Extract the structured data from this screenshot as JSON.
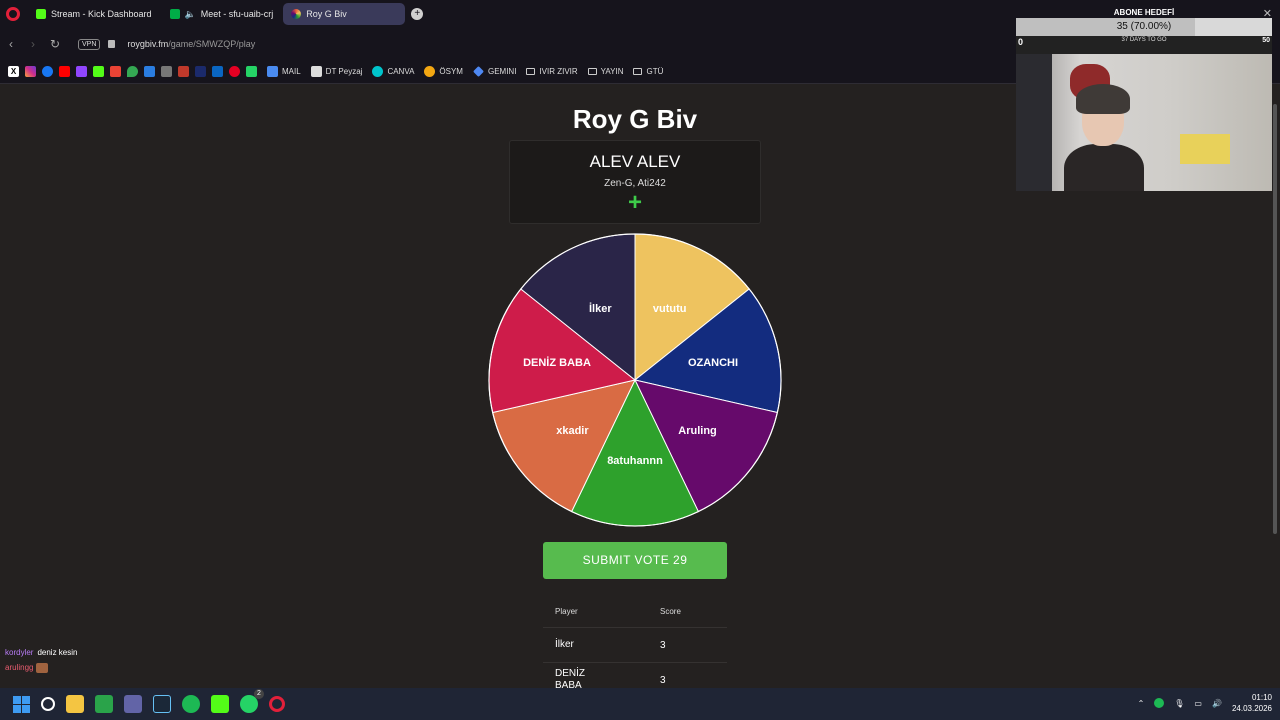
{
  "browser": {
    "tabs": [
      {
        "label": "Stream - Kick Dashboard",
        "color": "#53fc18"
      },
      {
        "label": "Meet - sfu-uaib-crj",
        "color": "#00ac47"
      },
      {
        "label": "Roy G Biv",
        "color": "#e85c3b"
      }
    ],
    "url_host": "roygbiv.fm",
    "url_path": "/game/SMWZQP/play",
    "vpn_label": "VPN",
    "bookmarks": [
      {
        "label": "MAIL",
        "icon": "mail-icon"
      },
      {
        "label": "DT Peyzaj",
        "icon": "dt-icon"
      },
      {
        "label": "CANVA",
        "icon": "canva-icon"
      },
      {
        "label": "ÖSYM",
        "icon": "osym-icon"
      },
      {
        "label": "GEMINI",
        "icon": "gemini-icon"
      },
      {
        "label": "IVIR ZIVIR",
        "icon": "folder-icon"
      },
      {
        "label": "YAYIN",
        "icon": "folder-icon"
      },
      {
        "label": "GTÜ",
        "icon": "folder-icon"
      }
    ]
  },
  "game": {
    "title": "Roy G Biv",
    "prompt": {
      "title": "ALEV ALEV",
      "subtitle": "Zen-G, Ati242",
      "add_symbol": "+"
    },
    "wheel": [
      {
        "label": "vututu",
        "color": "#eec35f"
      },
      {
        "label": "OZANCHI",
        "color": "#132c7f"
      },
      {
        "label": "Aruling",
        "color": "#660a6b"
      },
      {
        "label": "8atuhannn",
        "color": "#2ea12c"
      },
      {
        "label": "xkadir",
        "color": "#d96b44"
      },
      {
        "label": "DENİZ BABA",
        "color": "#ce1c4a"
      },
      {
        "label": "İlker",
        "color": "#2a2548"
      }
    ],
    "submit_label": "SUBMIT VOTE 29",
    "scoreboard": {
      "headers": {
        "player": "Player",
        "score": "Score"
      },
      "rows": [
        {
          "player": "İlker",
          "score": "3"
        },
        {
          "player": "DENİZ BABA",
          "score": "3"
        }
      ]
    }
  },
  "overlay": {
    "goal_title": "ABONE HEDEFİ",
    "goal_progress_text": "35 (70.00%)",
    "goal_progress": 0.7,
    "goal_left": "0",
    "goal_right": "50",
    "goal_days": "37 DAYS TO GO"
  },
  "chat": [
    {
      "user": "kordyler",
      "message": "deniz kesin"
    },
    {
      "user": "arulingg",
      "message": ""
    }
  ],
  "taskbar": {
    "time": "01:10",
    "date": "24.03.2026",
    "whatsapp_badge": "2"
  }
}
